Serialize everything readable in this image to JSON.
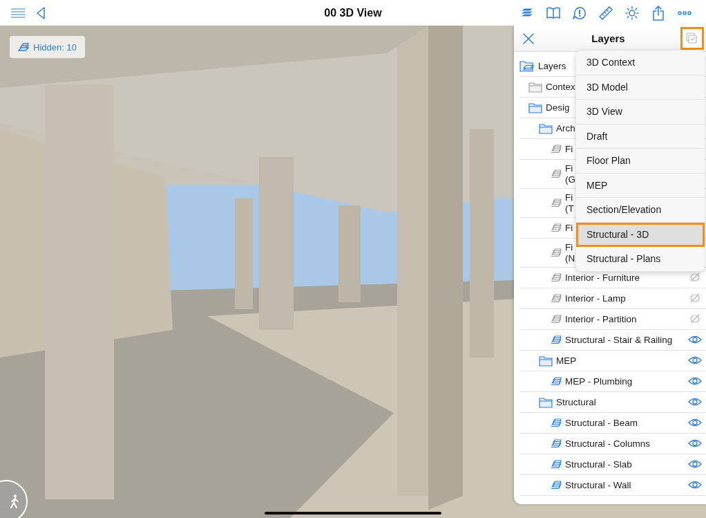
{
  "toolbar": {
    "title": "00 3D View"
  },
  "hidden_badge": {
    "label": "Hidden: 10"
  },
  "layers_panel": {
    "title": "Layers",
    "filter_active": true,
    "tree": [
      {
        "kind": "root",
        "label": "Layers",
        "visible": true,
        "children": [
          {
            "kind": "folder",
            "label": "Contex",
            "visible": false
          },
          {
            "kind": "folder",
            "label": "Desig",
            "visible": true,
            "children": [
              {
                "kind": "folder",
                "label": "Arch",
                "visible": true,
                "children": [
                  {
                    "kind": "layer",
                    "lines": [
                      "Fi"
                    ],
                    "visible": false
                  },
                  {
                    "kind": "layer",
                    "lines": [
                      "Fi",
                      "(G"
                    ],
                    "visible": false
                  },
                  {
                    "kind": "layer",
                    "lines": [
                      "Fi",
                      "(T"
                    ],
                    "visible": false
                  },
                  {
                    "kind": "layer",
                    "lines": [
                      "Fi"
                    ],
                    "visible": false
                  },
                  {
                    "kind": "layer",
                    "lines": [
                      "Fi",
                      "(N"
                    ],
                    "visible": false
                  },
                  {
                    "kind": "layer",
                    "lines": [
                      "Interior - Furniture"
                    ],
                    "visible": false,
                    "eye": true
                  },
                  {
                    "kind": "layer",
                    "lines": [
                      "Interior - Lamp"
                    ],
                    "visible": false,
                    "eye": true
                  },
                  {
                    "kind": "layer",
                    "lines": [
                      "Interior - Partition"
                    ],
                    "visible": false,
                    "eye": true
                  },
                  {
                    "kind": "layer",
                    "lines": [
                      "Structural - Stair & Railing"
                    ],
                    "visible": true,
                    "eye": true
                  }
                ]
              },
              {
                "kind": "folder",
                "label": "MEP",
                "visible": true,
                "eye": true,
                "children": [
                  {
                    "kind": "layer",
                    "lines": [
                      "MEP - Plumbing"
                    ],
                    "visible": true,
                    "eye": true
                  }
                ]
              },
              {
                "kind": "folder",
                "label": "Structural",
                "visible": true,
                "eye": true,
                "children": [
                  {
                    "kind": "layer",
                    "lines": [
                      "Structural - Beam"
                    ],
                    "visible": true,
                    "eye": true
                  },
                  {
                    "kind": "layer",
                    "lines": [
                      "Structural - Columns"
                    ],
                    "visible": true,
                    "eye": true
                  },
                  {
                    "kind": "layer",
                    "lines": [
                      "Structural - Slab"
                    ],
                    "visible": true,
                    "eye": true
                  },
                  {
                    "kind": "layer",
                    "lines": [
                      "Structural - Wall"
                    ],
                    "visible": true,
                    "eye": true
                  }
                ]
              }
            ]
          }
        ]
      }
    ]
  },
  "filter_menu": [
    {
      "label": "3D Context",
      "selected": false
    },
    {
      "label": "3D Model",
      "selected": false
    },
    {
      "label": "3D View",
      "selected": false
    },
    {
      "label": "Draft",
      "selected": false
    },
    {
      "label": "Floor Plan",
      "selected": false
    },
    {
      "label": "MEP",
      "selected": false
    },
    {
      "label": "Section/Elevation",
      "selected": false
    },
    {
      "label": "Structural - 3D",
      "selected": true
    },
    {
      "label": "Structural - Plans",
      "selected": false
    }
  ]
}
